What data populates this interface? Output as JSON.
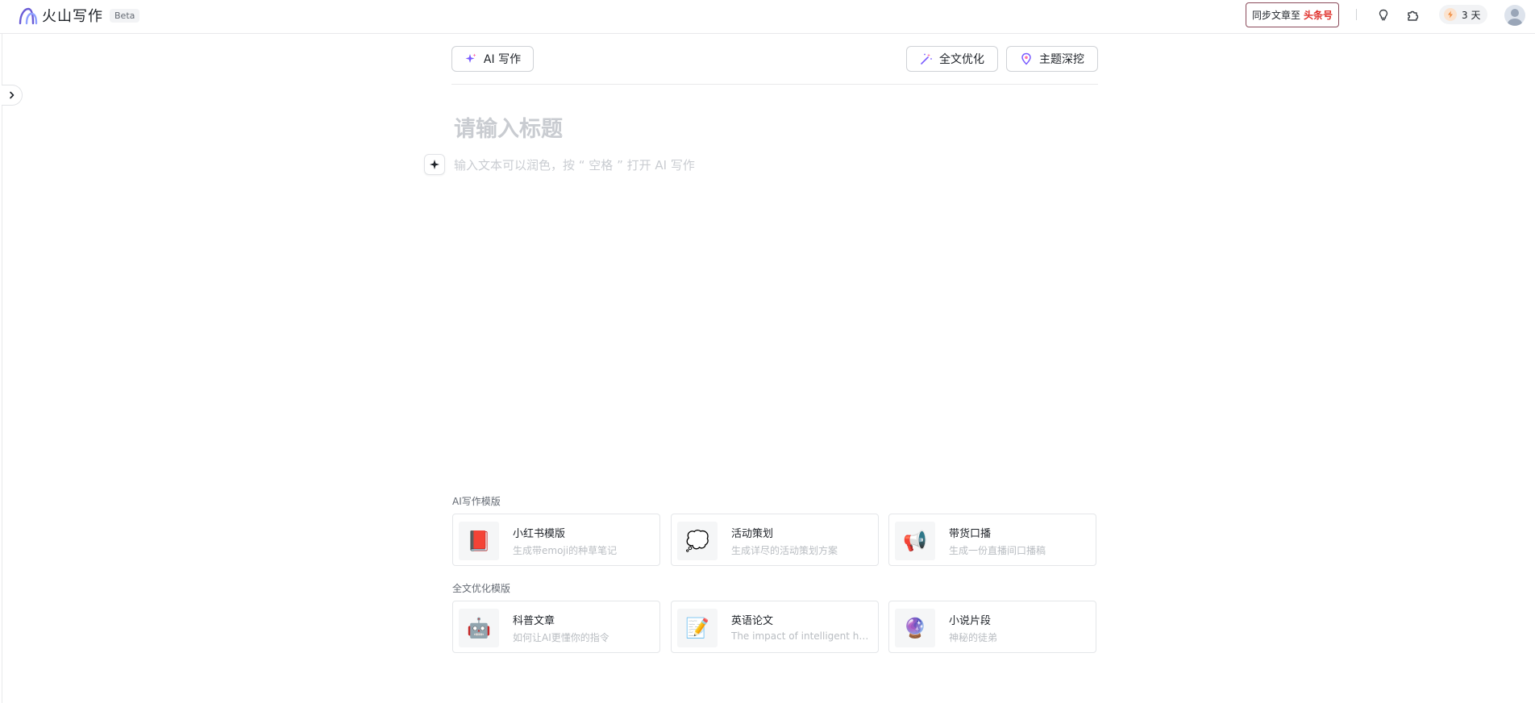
{
  "header": {
    "app_name": "火山写作",
    "beta": "Beta",
    "sync_prefix": "同步文章至",
    "sync_brand": "头条号",
    "days_label": "3 天"
  },
  "icons": {
    "idea": "lightbulb-icon",
    "plugin": "puzzle-icon",
    "energy": "bolt-icon",
    "user": "avatar-icon",
    "expand": "chevron-right-icon"
  },
  "toolbar": {
    "ai_write": "AI 写作",
    "full_optimize": "全文优化",
    "topic_dig": "主题深挖"
  },
  "editor": {
    "title_placeholder": "请输入标题",
    "body_placeholder": "输入文本可以润色，按 “ 空格 ” 打开 AI 写作"
  },
  "templates": {
    "ai_label": "AI写作模版",
    "ai_items": [
      {
        "emoji": "📕",
        "title": "小红书模版",
        "desc": "生成带emoji的种草笔记"
      },
      {
        "emoji": "💭",
        "title": "活动策划",
        "desc": "生成详尽的活动策划方案"
      },
      {
        "emoji": "📢",
        "title": "带货口播",
        "desc": "生成一份直播间口播稿"
      }
    ],
    "opt_label": "全文优化模版",
    "opt_items": [
      {
        "emoji": "🤖",
        "title": "科普文章",
        "desc": "如何让AI更懂你的指令"
      },
      {
        "emoji": "📝",
        "title": "英语论文",
        "desc": "The impact of intelligent hou…"
      },
      {
        "emoji": "🔮",
        "title": "小说片段",
        "desc": "神秘的徒弟"
      }
    ]
  },
  "colors": {
    "brand_red": "#e0302b",
    "accent_purple": "#7a5cff",
    "placeholder": "#c9ccd1"
  }
}
